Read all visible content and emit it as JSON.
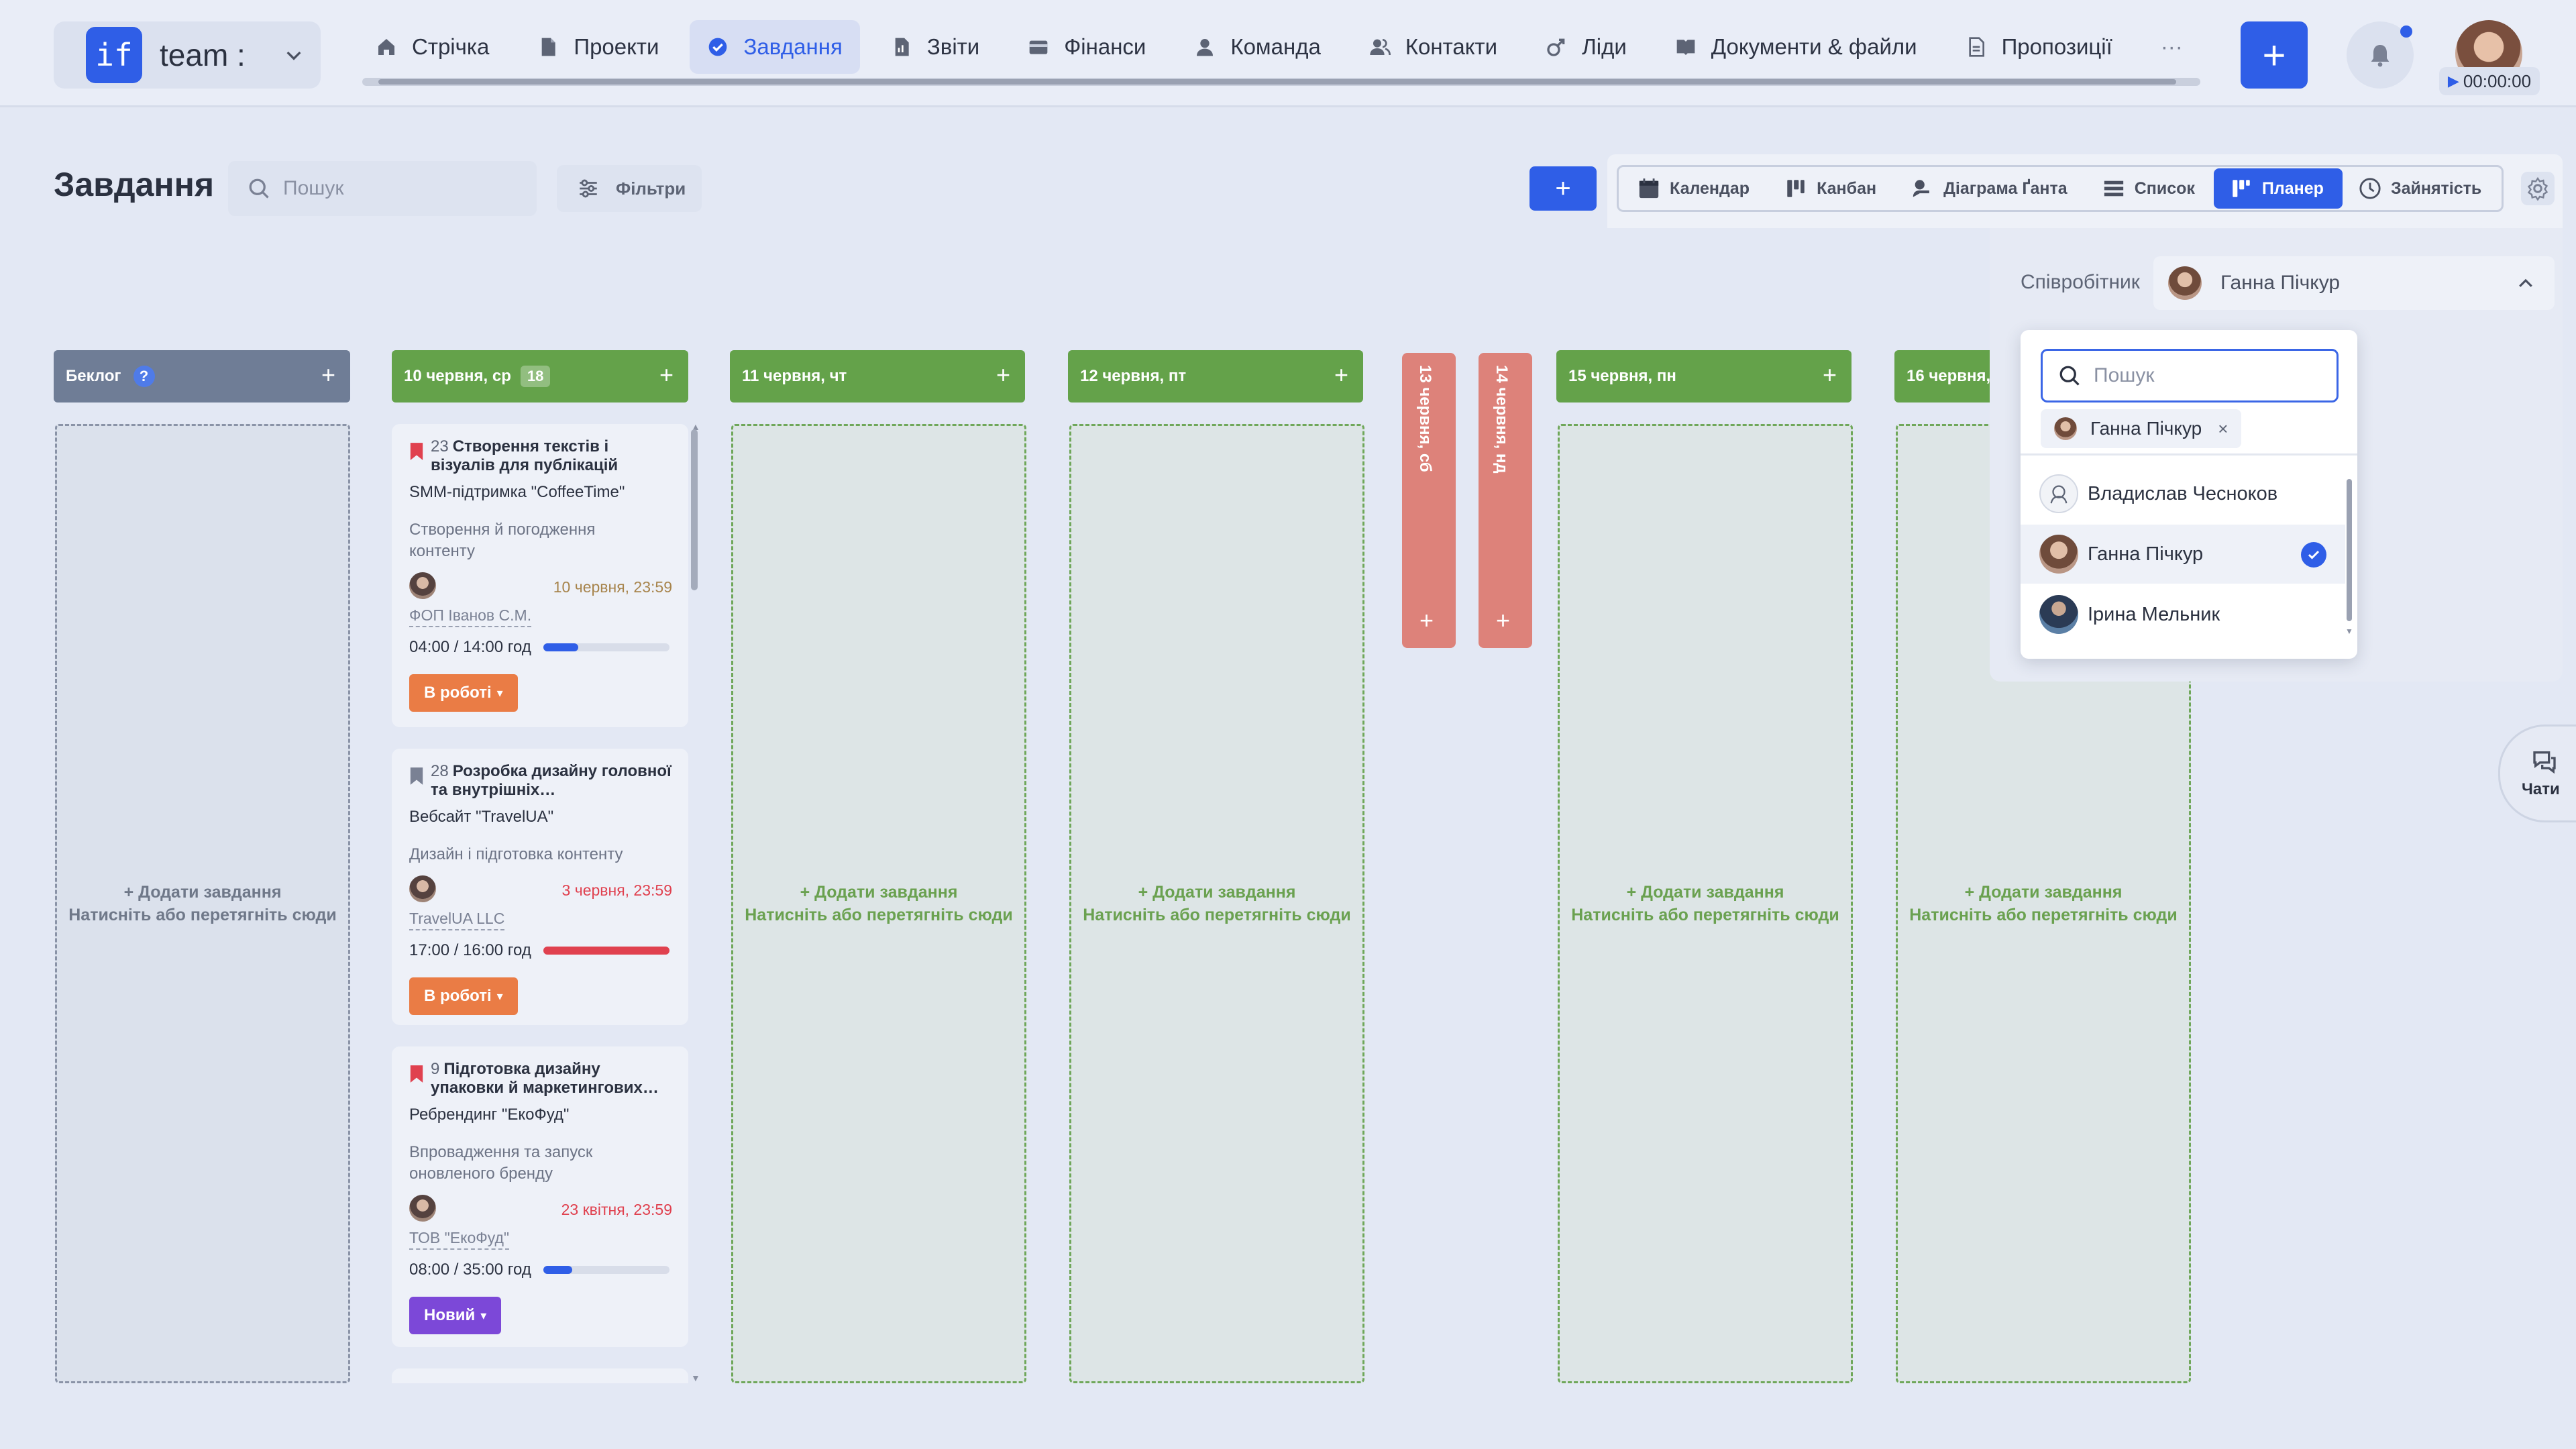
{
  "workspace": {
    "logo_text": "if",
    "name": "team :"
  },
  "nav": [
    {
      "label": "Стрічка",
      "icon": "home-icon",
      "active": false
    },
    {
      "label": "Проекти",
      "icon": "file-icon",
      "active": false
    },
    {
      "label": "Завдання",
      "icon": "check-circle-icon",
      "active": true
    },
    {
      "label": "Звіти",
      "icon": "report-icon",
      "active": false
    },
    {
      "label": "Фінанси",
      "icon": "wallet-icon",
      "active": false
    },
    {
      "label": "Команда",
      "icon": "user-icon",
      "active": false
    },
    {
      "label": "Контакти",
      "icon": "contacts-icon",
      "active": false
    },
    {
      "label": "Ліди",
      "icon": "leads-icon",
      "active": false
    },
    {
      "label": "Документи & файли",
      "icon": "book-icon",
      "active": false
    },
    {
      "label": "Пропозиції",
      "icon": "document-icon",
      "active": false
    }
  ],
  "nav_more": "···",
  "topbar": {
    "add_label": "+",
    "timer": "00:00:00",
    "timer_play": "▶"
  },
  "header": {
    "title": "Завдання",
    "search_placeholder": "Пошук",
    "filters_label": "Фільтри",
    "add_label": "+"
  },
  "views": [
    {
      "label": "Календар",
      "icon": "calendar-icon",
      "active": false
    },
    {
      "label": "Канбан",
      "icon": "kanban-icon",
      "active": false
    },
    {
      "label": "Діаграма Ґанта",
      "icon": "gantt-icon",
      "active": false
    },
    {
      "label": "Список",
      "icon": "list-icon",
      "active": false
    },
    {
      "label": "Планер",
      "icon": "planner-icon",
      "active": true
    },
    {
      "label": "Зайнятість",
      "icon": "clock-icon",
      "active": false
    }
  ],
  "columns": {
    "backlog": {
      "title": "Беклог",
      "help": "?",
      "add": "+"
    },
    "jun10": {
      "title": "10 червня, ср",
      "count": "18",
      "add": "+"
    },
    "jun11": {
      "title": "11 червня, чт",
      "add": "+"
    },
    "jun12": {
      "title": "12 червня, пт",
      "add": "+"
    },
    "jun13": {
      "title": "13 червня, сб",
      "add": "+"
    },
    "jun14": {
      "title": "14 червня, нд",
      "add": "+"
    },
    "jun15": {
      "title": "15 червня, пн",
      "add": "+"
    },
    "jun16": {
      "title": "16 червня, вт",
      "add": "+"
    }
  },
  "drop_zone": {
    "add_text": "+ Додати завдання",
    "hint": "Натисніть або перетягніть сюди"
  },
  "tasks": [
    {
      "num": "23",
      "title": "Створення текстів і візуалів для публікацій",
      "project": "SMM-підтримка \"CoffeeTime\"",
      "desc": "Створення й погодження контенту",
      "date": "10 червня, 23:59",
      "date_state": "normal",
      "client": "ФОП Іванов С.М.",
      "time": "04:00 / 14:00 год",
      "progress": 0.28,
      "progress_color": "#2f5ee7",
      "status": "В роботі",
      "status_color": "orange"
    },
    {
      "num": "28",
      "title": "Розробка дизайну головної та внутрішніх…",
      "project": "Вебсайт \"TravelUA\"",
      "desc": "Дизайн і підготовка контенту",
      "date": "3 червня, 23:59",
      "date_state": "overdue",
      "client": "TravelUA LLC",
      "time": "17:00 / 16:00 год",
      "progress": 1.0,
      "progress_color": "#e0414f",
      "status": "В роботі",
      "status_color": "orange"
    },
    {
      "num": "9",
      "title": "Підготовка дизайну упаковки й маркетингових…",
      "project": "Ребрендинг \"ЕкоФуд\"",
      "desc": "Впровадження та запуск оновленого бренду",
      "date": "23 квітня, 23:59",
      "date_state": "overdue",
      "client": "ТОВ \"ЕкоФуд\"",
      "time": "08:00 / 35:00 год",
      "progress": 0.23,
      "progress_color": "#2f5ee7",
      "status": "Новий",
      "status_color": "purple"
    }
  ],
  "employee_filter": {
    "label": "Співробітник",
    "selected": "Ганна Пічкур",
    "search_placeholder": "Пошук",
    "chip": "Ганна Пічкур",
    "chip_remove": "×",
    "options": [
      {
        "name": "Владислав Чесноков",
        "selected": false
      },
      {
        "name": "Ганна Пічкур",
        "selected": true
      },
      {
        "name": "Ірина Мельник",
        "selected": false
      }
    ]
  },
  "chats": {
    "label": "Чати"
  }
}
